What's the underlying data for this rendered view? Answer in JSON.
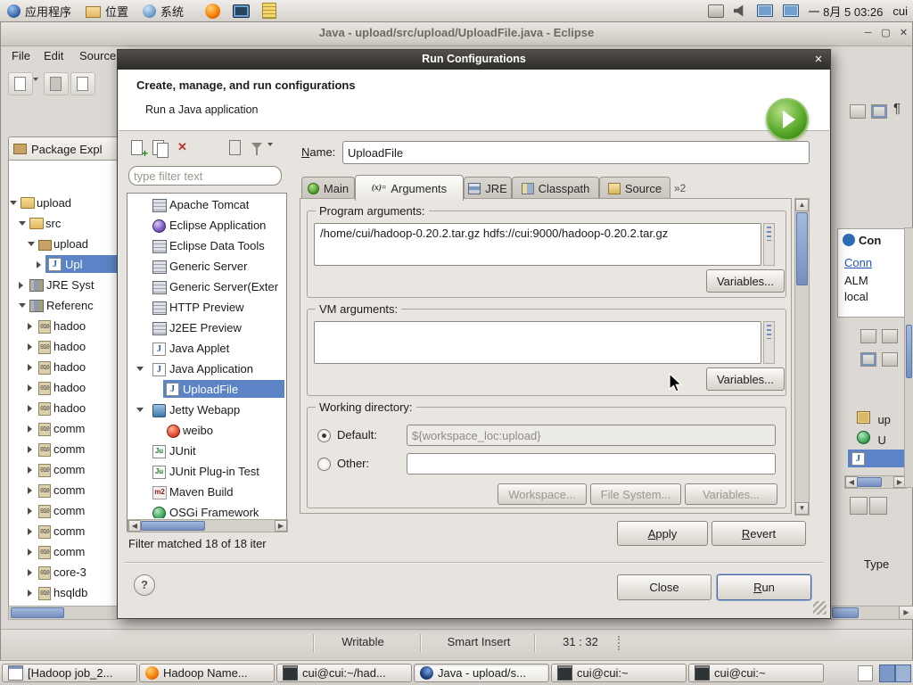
{
  "icons": {
    "close": "✕",
    "minimize": "─",
    "maximize": "▢",
    "pilcrow": "¶",
    "left_arrow": "◀",
    "right_arrow": "▶",
    "up_arrow": "▲",
    "down_arrow": "▼",
    "help": "?",
    "args_tab": "(x)="
  },
  "top_panel": {
    "menus": [
      {
        "label": "应用程序"
      },
      {
        "label": "位置"
      },
      {
        "label": "系统"
      }
    ],
    "clock": "一 8月 5 03:26",
    "user": "cui"
  },
  "eclipse": {
    "title": "Java - upload/src/upload/UploadFile.java - Eclipse",
    "menus": [
      {
        "label": "File"
      },
      {
        "label": "Edit"
      },
      {
        "label": "Source"
      }
    ],
    "package_explorer": {
      "title": "Package Expl",
      "items": [
        {
          "label": "upload"
        },
        {
          "label": "src"
        },
        {
          "label": "upload"
        },
        {
          "label": "Upl"
        },
        {
          "label": "JRE Syst"
        },
        {
          "label": "Referenc"
        },
        {
          "label": "hadoo"
        },
        {
          "label": "hadoo"
        },
        {
          "label": "hadoo"
        },
        {
          "label": "hadoo"
        },
        {
          "label": "hadoo"
        },
        {
          "label": "comm"
        },
        {
          "label": "comm"
        },
        {
          "label": "comm"
        },
        {
          "label": "comm"
        },
        {
          "label": "comm"
        },
        {
          "label": "comm"
        },
        {
          "label": "comm"
        },
        {
          "label": "core-3"
        },
        {
          "label": "hsqldb"
        }
      ]
    },
    "right_panel": {
      "heading": "Con",
      "link": "Conn",
      "alm": "ALM",
      "local": "local",
      "item_up": "up",
      "item_u": "U",
      "type_label": "Type"
    },
    "status": {
      "writable": "Writable",
      "insert_mode": "Smart Insert",
      "caret": "31 : 32"
    }
  },
  "dialog": {
    "title": "Run Configurations",
    "header_title": "Create, manage, and run configurations",
    "header_subtitle": "Run a Java application",
    "filter_placeholder": "type filter text",
    "tree": [
      {
        "label": "Apache Tomcat"
      },
      {
        "label": "Eclipse Application"
      },
      {
        "label": "Eclipse Data Tools"
      },
      {
        "label": "Generic Server"
      },
      {
        "label": "Generic Server(Exter"
      },
      {
        "label": "HTTP Preview"
      },
      {
        "label": "J2EE Preview"
      },
      {
        "label": "Java Applet"
      },
      {
        "label": "Java Application"
      },
      {
        "label": "UploadFile"
      },
      {
        "label": "Jetty Webapp"
      },
      {
        "label": "weibo"
      },
      {
        "label": "JUnit"
      },
      {
        "label": "JUnit Plug-in Test"
      },
      {
        "label": "Maven Build"
      },
      {
        "label": "OSGi Framework"
      }
    ],
    "filter_status": "Filter matched 18 of 18 iter",
    "name_label": "Name:",
    "name_value": "UploadFile",
    "tabs": [
      {
        "label": "Main"
      },
      {
        "label": "Arguments"
      },
      {
        "label": "JRE"
      },
      {
        "label": "Classpath"
      },
      {
        "label": "Source"
      },
      {
        "label": "»2"
      }
    ],
    "program_group": {
      "legend": "Program arguments:",
      "value": "/home/cui/hadoop-0.20.2.tar.gz hdfs://cui:9000/hadoop-0.20.2.tar.gz",
      "variables": "Variables..."
    },
    "vm_group": {
      "legend": "VM arguments:",
      "value": "",
      "variables": "Variables..."
    },
    "workdir_group": {
      "legend": "Working directory:",
      "default_label": "Default:",
      "default_value": "${workspace_loc:upload}",
      "other_label": "Other:",
      "workspace": "Workspace...",
      "filesystem": "File System...",
      "variables": "Variables..."
    },
    "apply": "Apply",
    "revert": "Revert",
    "close_btn": "Close",
    "run": "Run"
  },
  "taskbar": {
    "items": [
      {
        "label": "[Hadoop job_2..."
      },
      {
        "label": "Hadoop Name..."
      },
      {
        "label": "cui@cui:~/had..."
      },
      {
        "label": "Java - upload/s..."
      },
      {
        "label": "cui@cui:~"
      },
      {
        "label": "cui@cui:~"
      }
    ]
  }
}
